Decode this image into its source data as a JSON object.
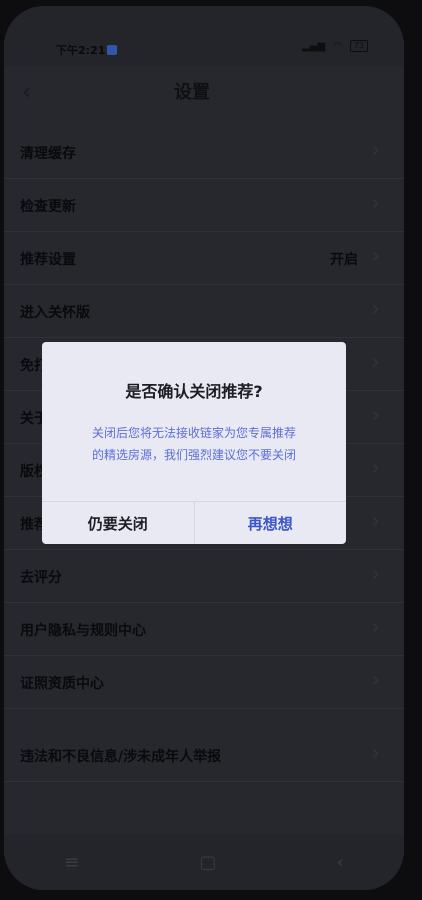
{
  "status_bar": {
    "time": "下午2:21",
    "battery": "73"
  },
  "header": {
    "title": "设置"
  },
  "settings": [
    {
      "label": "清理缓存"
    },
    {
      "label": "检查更新"
    },
    {
      "label": "推荐设置",
      "value": "开启"
    },
    {
      "label": "进入关怀版"
    },
    {
      "label": "免打扰"
    },
    {
      "label": "关于"
    },
    {
      "label": "版权"
    },
    {
      "label": "推荐"
    },
    {
      "label": "去评分"
    },
    {
      "label": "用户隐私与规则中心"
    },
    {
      "label": "证照资质中心"
    },
    {
      "label": "违法和不良信息/涉未成年人举报"
    }
  ],
  "dialog": {
    "title": "是否确认关闭推荐?",
    "body_line1": "关闭后您将无法接收链家为您专属推荐",
    "body_line2": "的精选房源，我们强烈建议您不要关闭",
    "cancel_label": "仍要关闭",
    "confirm_label": "再想想"
  },
  "icons": {
    "back": "back-arrow-icon",
    "chevron": "chevron-right-icon",
    "signal": "signal-icon",
    "wifi": "wifi-icon",
    "battery": "battery-icon",
    "nav_menu": "menu-icon",
    "nav_home": "home-icon",
    "nav_back": "back-icon"
  }
}
